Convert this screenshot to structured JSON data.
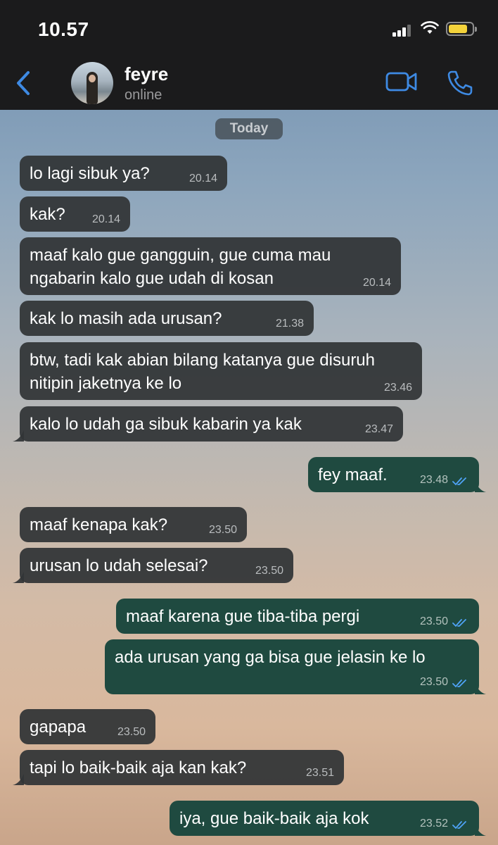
{
  "status_bar": {
    "time": "10.57"
  },
  "header": {
    "contact_name": "feyre",
    "contact_status": "online"
  },
  "date_separator": "Today",
  "colors": {
    "accent": "#3e8ae3",
    "incoming_bubble": "#323537",
    "outgoing_bubble": "#1f4a40",
    "battery": "#f4d33b"
  },
  "icons": {
    "back": "chevron-left-icon",
    "video": "video-camera-icon",
    "call": "phone-icon",
    "read_receipt": "double-check-icon"
  },
  "messages": [
    {
      "dir": "in",
      "text": "lo lagi sibuk ya?",
      "time": "20.14"
    },
    {
      "dir": "in",
      "text": "kak?",
      "time": "20.14"
    },
    {
      "dir": "in",
      "text": "maaf kalo gue gangguin, gue cuma mau ngabarin kalo gue udah di kosan",
      "time": "20.14"
    },
    {
      "dir": "in",
      "text": "kak lo masih ada urusan?",
      "time": "21.38"
    },
    {
      "dir": "in",
      "text": "btw, tadi kak abian bilang katanya gue disuruh nitipin jaketnya ke lo",
      "time": "23.46"
    },
    {
      "dir": "in",
      "text": "kalo lo udah ga sibuk kabarin ya kak",
      "time": "23.47"
    },
    {
      "dir": "out",
      "text": "fey maaf.",
      "time": "23.48",
      "read": true
    },
    {
      "dir": "in",
      "text": "maaf kenapa kak?",
      "time": "23.50"
    },
    {
      "dir": "in",
      "text": "urusan lo udah selesai?",
      "time": "23.50"
    },
    {
      "dir": "out",
      "text": "maaf karena gue tiba-tiba pergi",
      "time": "23.50",
      "read": true
    },
    {
      "dir": "out",
      "text": "ada urusan yang ga bisa gue jelasin ke lo",
      "time": "23.50",
      "read": true
    },
    {
      "dir": "in",
      "text": "gapapa",
      "time": "23.50"
    },
    {
      "dir": "in",
      "text": "tapi lo baik-baik aja kan kak?",
      "time": "23.51"
    },
    {
      "dir": "out",
      "text": "iya, gue baik-baik aja kok",
      "time": "23.52",
      "read": true
    }
  ]
}
